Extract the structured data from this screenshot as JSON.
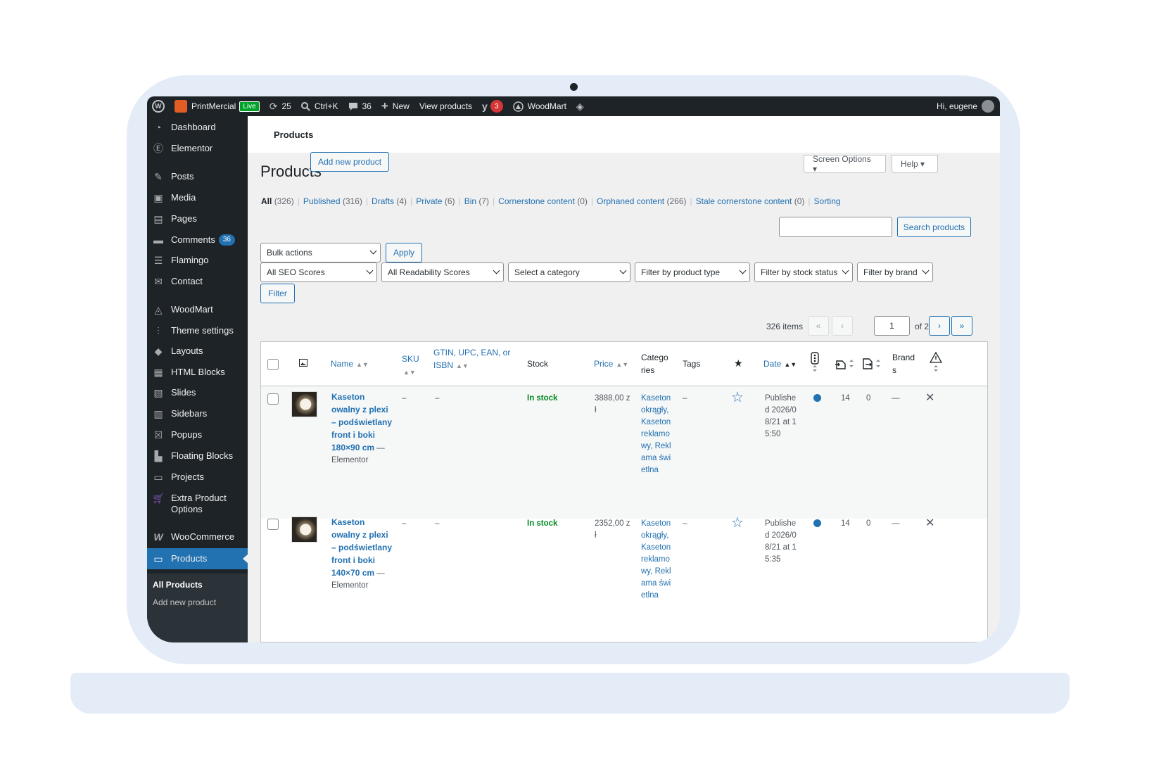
{
  "adminbar": {
    "site_name": "PrintMercial",
    "live_label": "Live",
    "updates_count": "25",
    "search_shortcut": "Ctrl+K",
    "comments_count": "36",
    "new_label": "New",
    "view_products": "View products",
    "yoast_badge": "3",
    "woodmart_label": "WoodMart",
    "greeting": "Hi, eugene"
  },
  "sidebar": {
    "items": [
      {
        "label": "Dashboard",
        "icon": "dashboard-icon"
      },
      {
        "label": "Elementor",
        "icon": "elementor-icon"
      },
      {
        "label": "Posts",
        "icon": "pin-icon"
      },
      {
        "label": "Media",
        "icon": "media-icon"
      },
      {
        "label": "Pages",
        "icon": "pages-icon"
      },
      {
        "label": "Comments",
        "icon": "comment-icon",
        "badge": "36"
      },
      {
        "label": "Flamingo",
        "icon": "flamingo-icon"
      },
      {
        "label": "Contact",
        "icon": "mail-icon"
      },
      {
        "label": "WoodMart",
        "icon": "woodmart-icon"
      },
      {
        "label": "Theme settings",
        "icon": "sliders-icon"
      },
      {
        "label": "Layouts",
        "icon": "layers-icon"
      },
      {
        "label": "HTML Blocks",
        "icon": "html-icon"
      },
      {
        "label": "Slides",
        "icon": "slides-icon"
      },
      {
        "label": "Sidebars",
        "icon": "sidebar-icon"
      },
      {
        "label": "Popups",
        "icon": "popup-icon"
      },
      {
        "label": "Floating Blocks",
        "icon": "floating-icon"
      },
      {
        "label": "Projects",
        "icon": "briefcase-icon"
      },
      {
        "label": "Extra Product Options",
        "icon": "cart-icon"
      },
      {
        "label": "WooCommerce",
        "icon": "woo-icon"
      },
      {
        "label": "Products",
        "icon": "products-icon"
      }
    ],
    "submenu": [
      "All Products",
      "Add new product"
    ]
  },
  "header": {
    "topbar_title": "Products",
    "page_title": "Products",
    "add_new": "Add new product",
    "screen_options": "Screen Options ▾",
    "help": "Help ▾"
  },
  "views": {
    "all": "All",
    "all_count": "(326)",
    "published": "Published",
    "published_count": "(316)",
    "drafts": "Drafts",
    "drafts_count": "(4)",
    "private": "Private",
    "private_count": "(6)",
    "bin": "Bin",
    "bin_count": "(7)",
    "cornerstone": "Cornerstone content",
    "cornerstone_count": "(0)",
    "orphaned": "Orphaned content",
    "orphaned_count": "(266)",
    "stale": "Stale cornerstone content",
    "stale_count": "(0)",
    "sorting": "Sorting"
  },
  "search": {
    "button": "Search products",
    "value": ""
  },
  "bulk": {
    "selected": "Bulk actions",
    "apply": "Apply"
  },
  "filters": {
    "seo": "All SEO Scores",
    "readability": "All Readability Scores",
    "category": "Select a category",
    "product_type": "Filter by product type",
    "stock": "Filter by stock status",
    "brand": "Filter by brand",
    "filter_button": "Filter"
  },
  "pagination": {
    "items": "326 items",
    "first": "«",
    "prev": "‹",
    "current": "1",
    "of": "of 2",
    "next": "›",
    "last": "»"
  },
  "table": {
    "columns": {
      "name": "Name",
      "sku": "SKU",
      "gtin": "GTIN, UPC, EAN, or ISBN",
      "stock": "Stock",
      "price": "Price",
      "categories": "Catego ries",
      "tags": "Tags",
      "date": "Date",
      "brands": "Brand s"
    },
    "rows": [
      {
        "name": "Kaseton owalny z plexi – podświetlany front i boki 180×90 cm",
        "suffix": "— Elementor",
        "sku": "–",
        "gtin": "–",
        "stock": "In stock",
        "price": "3888,00 zł",
        "categories": "Kaseton okrągły, Kaseton reklamowy, Reklama świetlna",
        "tags": "–",
        "date": "Published 2026/08/21 at 15:50",
        "col_a": "14",
        "col_b": "0",
        "brand": "—"
      },
      {
        "name": "Kaseton owalny z plexi – podświetlany front i boki 140×70 cm",
        "suffix": "— Elementor",
        "sku": "–",
        "gtin": "–",
        "stock": "In stock",
        "price": "2352,00 zł",
        "categories": "Kaseton okrągły, Kaseton reklamowy, Reklama świetlna",
        "tags": "–",
        "date": "Published 2026/08/21 at 15:35",
        "col_a": "14",
        "col_b": "0",
        "brand": "—"
      }
    ]
  },
  "colors": {
    "accent": "#2271b1",
    "adminbar": "#1d2327",
    "frame": "#e3ecf7",
    "in_stock": "#008a20"
  }
}
